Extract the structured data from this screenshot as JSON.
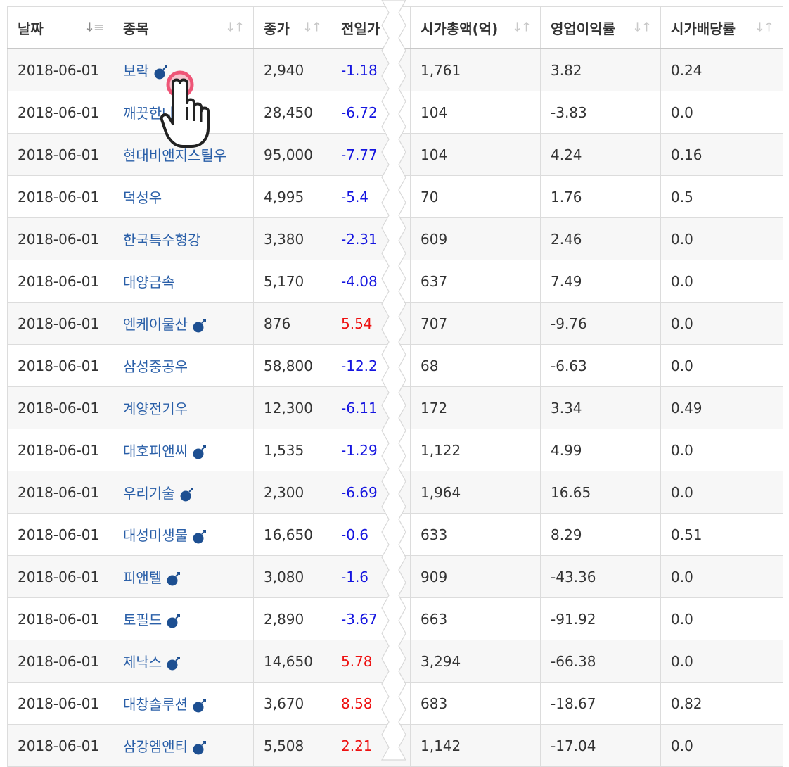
{
  "columns": [
    "날짜",
    "종목",
    "종가",
    "전일가",
    "시가총액(억)",
    "영업이익률",
    "시가배당률"
  ],
  "rows": [
    {
      "date": "2018-06-01",
      "name": "보락",
      "close": "2,940",
      "change": "-1.18",
      "cap": "1,761",
      "margin": "3.82",
      "div": "0.24"
    },
    {
      "date": "2018-06-01",
      "name": "깨끗한나",
      "close": "28,450",
      "change": "-6.72",
      "cap": "104",
      "margin": "-3.83",
      "div": "0.0"
    },
    {
      "date": "2018-06-01",
      "name": "현대비앤지스틸우",
      "close": "95,000",
      "change": "-7.77",
      "cap": "104",
      "margin": "4.24",
      "div": "0.16"
    },
    {
      "date": "2018-06-01",
      "name": "덕성우",
      "close": "4,995",
      "change": "-5.4",
      "cap": "70",
      "margin": "1.76",
      "div": "0.5"
    },
    {
      "date": "2018-06-01",
      "name": "한국특수형강",
      "close": "3,380",
      "change": "-2.31",
      "cap": "609",
      "margin": "2.46",
      "div": "0.0"
    },
    {
      "date": "2018-06-01",
      "name": "대양금속",
      "close": "5,170",
      "change": "-4.08",
      "cap": "637",
      "margin": "7.49",
      "div": "0.0"
    },
    {
      "date": "2018-06-01",
      "name": "엔케이물산",
      "close": "876",
      "change": "5.54",
      "cap": "707",
      "margin": "-9.76",
      "div": "0.0"
    },
    {
      "date": "2018-06-01",
      "name": "삼성중공우",
      "close": "58,800",
      "change": "-12.2",
      "cap": "68",
      "margin": "-6.63",
      "div": "0.0"
    },
    {
      "date": "2018-06-01",
      "name": "계양전기우",
      "close": "12,300",
      "change": "-6.11",
      "cap": "172",
      "margin": "3.34",
      "div": "0.49"
    },
    {
      "date": "2018-06-01",
      "name": "대호피앤씨",
      "close": "1,535",
      "change": "-1.29",
      "cap": "1,122",
      "margin": "4.99",
      "div": "0.0"
    },
    {
      "date": "2018-06-01",
      "name": "우리기술",
      "close": "2,300",
      "change": "-6.69",
      "cap": "1,964",
      "margin": "16.65",
      "div": "0.0"
    },
    {
      "date": "2018-06-01",
      "name": "대성미생물",
      "close": "16,650",
      "change": "-0.6",
      "cap": "633",
      "margin": "8.29",
      "div": "0.51"
    },
    {
      "date": "2018-06-01",
      "name": "피앤텔",
      "close": "3,080",
      "change": "-1.6",
      "cap": "909",
      "margin": "-43.36",
      "div": "0.0"
    },
    {
      "date": "2018-06-01",
      "name": "토필드",
      "close": "2,890",
      "change": "-3.67",
      "cap": "663",
      "margin": "-91.92",
      "div": "0.0"
    },
    {
      "date": "2018-06-01",
      "name": "제낙스",
      "close": "14,650",
      "change": "5.78",
      "cap": "3,294",
      "margin": "-66.38",
      "div": "0.0"
    },
    {
      "date": "2018-06-01",
      "name": "대창솔루션",
      "close": "3,670",
      "change": "8.58",
      "cap": "683",
      "margin": "-18.67",
      "div": "0.82"
    },
    {
      "date": "2018-06-01",
      "name": "삼강엠앤티",
      "close": "5,508",
      "change": "2.21",
      "cap": "1,142",
      "margin": "-17.04",
      "div": "0.0"
    }
  ],
  "bomb_rows": [
    0,
    6,
    9,
    10,
    11,
    12,
    13,
    14,
    15,
    16
  ],
  "colors": {
    "positive": "#ee1111",
    "negative": "#1515e0",
    "link": "#2a5fa8",
    "bomb": "#1d4f91"
  },
  "icons": {
    "sort": "sort-arrows-icon",
    "bomb": "bomb-icon",
    "cursor": "hand-pointer-icon"
  }
}
